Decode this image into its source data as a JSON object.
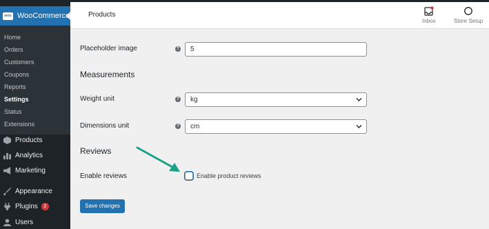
{
  "sidebar": {
    "plugin_name": "WooCommerce",
    "badge_text": "woo",
    "submenu": [
      "Home",
      "Orders",
      "Customers",
      "Coupons",
      "Reports",
      "Settings",
      "Status",
      "Extensions"
    ],
    "current_submenu": "Settings",
    "menu": [
      {
        "label": "Products",
        "icon": "box-icon"
      },
      {
        "label": "Analytics",
        "icon": "bar-chart-icon"
      },
      {
        "label": "Marketing",
        "icon": "megaphone-icon"
      },
      {
        "label": "Appearance",
        "icon": "brush-icon"
      },
      {
        "label": "Plugins",
        "icon": "plug-icon",
        "badge": "2"
      },
      {
        "label": "Users",
        "icon": "user-icon"
      }
    ]
  },
  "header": {
    "title": "Products",
    "inbox_label": "Inbox",
    "store_setup_label": "Store Setup"
  },
  "form": {
    "placeholder_image": {
      "label": "Placeholder image",
      "value": "5"
    },
    "measurements_title": "Measurements",
    "weight_unit": {
      "label": "Weight unit",
      "value": "kg"
    },
    "dimensions_unit": {
      "label": "Dimensions unit",
      "value": "cm"
    },
    "reviews_title": "Reviews",
    "enable_reviews": {
      "label": "Enable reviews",
      "checkbox_label": "Enable product reviews",
      "checked": false
    },
    "help_glyph": "?",
    "save_label": "Save changes"
  },
  "colors": {
    "sidebar_bg": "#1d2327",
    "accent": "#2271b1",
    "arrow": "#1aa187",
    "badge": "#d63638"
  }
}
